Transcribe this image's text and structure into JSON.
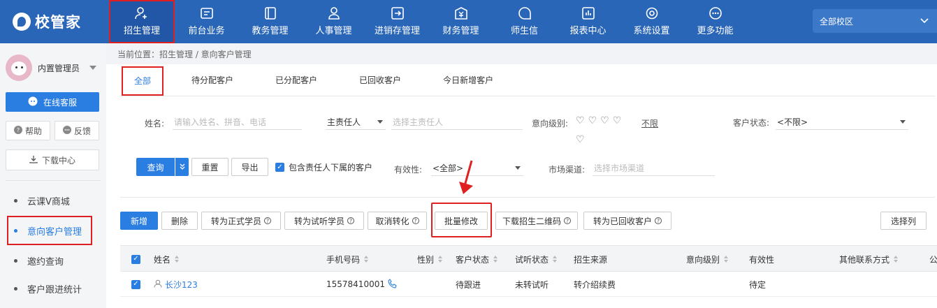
{
  "logo": {
    "text": "校管家"
  },
  "nav": {
    "items": [
      {
        "label": "招生管理",
        "icon": "user-plus-icon",
        "active": true
      },
      {
        "label": "前台业务",
        "icon": "monitor-icon"
      },
      {
        "label": "教务管理",
        "icon": "book-icon"
      },
      {
        "label": "人事管理",
        "icon": "person-icon"
      },
      {
        "label": "进销存管理",
        "icon": "inout-icon"
      },
      {
        "label": "财务管理",
        "icon": "yen-icon"
      },
      {
        "label": "师生信",
        "icon": "chat-icon"
      },
      {
        "label": "报表中心",
        "icon": "chart-icon"
      },
      {
        "label": "系统设置",
        "icon": "gear-icon"
      },
      {
        "label": "更多功能",
        "icon": "more-icon"
      }
    ],
    "campus": "全部校区"
  },
  "sidebar": {
    "user": "内置管理员",
    "service": "在线客服",
    "help": "帮助",
    "feedback": "反馈",
    "download": "下载中心",
    "menu": [
      {
        "label": "云课V商城"
      },
      {
        "label": "意向客户管理",
        "active": true
      },
      {
        "label": "邀约查询"
      },
      {
        "label": "客户跟进统计"
      }
    ]
  },
  "breadcrumb": "当前位置：招生管理 / 意向客户管理",
  "tabs": [
    "全部",
    "待分配客户",
    "已分配客户",
    "已回收客户",
    "今日新增客户"
  ],
  "filters": {
    "name_label": "姓名:",
    "name_placeholder": "请输入姓名、拼音、电话",
    "owner_select": "主责任人",
    "owner_placeholder": "选择主责任人",
    "intent_label": "意向级别:",
    "intent_unlimited": "不限",
    "status_label": "客户状态:",
    "status_value": "<不限>",
    "validity_label": "有效性:",
    "validity_value": "<全部>",
    "channel_label": "市场渠道:",
    "channel_placeholder": "选择市场渠道",
    "include_sub": "包含责任人下属的客户"
  },
  "buttons": {
    "query": "查询",
    "reset": "重置",
    "export": "导出",
    "add": "新增",
    "delete": "删除",
    "to_formal": "转为正式学员",
    "to_trial": "转为试听学员",
    "cancel_convert": "取消转化",
    "batch_edit": "批量修改",
    "download_qr": "下载招生二维码",
    "to_recycled": "转为已回收客户",
    "select_columns": "选择列"
  },
  "table": {
    "headers": [
      "姓名",
      "手机号码",
      "性别",
      "客户状态",
      "试听状态",
      "招生来源",
      "意向级别",
      "有效性",
      "其他联系方式",
      "公"
    ],
    "rows": [
      {
        "name": "长沙123",
        "phone": "15578410001",
        "gender": "",
        "status": "待跟进",
        "trial": "未转试听",
        "source": "转介绍续费",
        "intent": "",
        "validity": "待定"
      }
    ]
  },
  "colors": {
    "nav_bg": "#2a66b8",
    "accent": "#2a7de1",
    "highlight": "#e02020"
  }
}
